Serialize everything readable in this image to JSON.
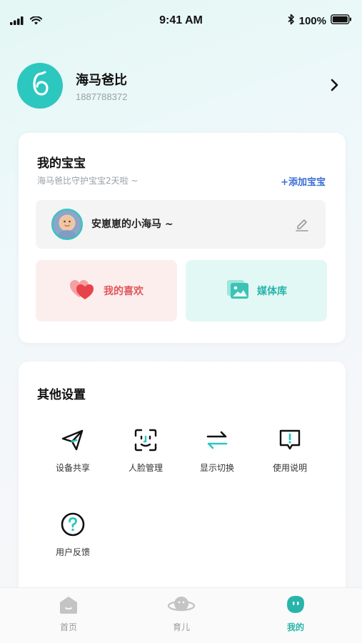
{
  "status_bar": {
    "time": "9:41 AM",
    "battery": "100%",
    "icons": [
      "signal-icon",
      "wifi-icon",
      "bluetooth-icon",
      "battery-icon"
    ]
  },
  "profile": {
    "name": "海马爸比",
    "phone": "1887788372",
    "avatar_icon": "seahorse-logo-icon",
    "accent": "#2cc7bf"
  },
  "baby_section": {
    "title": "我的宝宝",
    "subtitle": "海马爸比守护宝宝2天啦 ~",
    "add_label": "+添加宝宝",
    "baby_name": "安崽崽的小海马 ~",
    "favorites_label": "我的喜欢",
    "media_label": "媒体库"
  },
  "settings": {
    "title": "其他设置",
    "items": [
      {
        "label": "设备共享",
        "icon": "paper-plane-icon"
      },
      {
        "label": "人脸管理",
        "icon": "face-scan-icon"
      },
      {
        "label": "显示切换",
        "icon": "switch-arrows-icon"
      },
      {
        "label": "使用说明",
        "icon": "instructions-icon"
      },
      {
        "label": "用户反馈",
        "icon": "question-icon"
      }
    ]
  },
  "tabbar": {
    "tabs": [
      {
        "label": "首页",
        "icon": "home-icon",
        "active": false
      },
      {
        "label": "育儿",
        "icon": "planet-icon",
        "active": false
      },
      {
        "label": "我的",
        "icon": "me-icon",
        "active": true
      }
    ]
  },
  "colors": {
    "teal": "#2cc7bf",
    "link_blue": "#3a6ed8",
    "favorite_red": "#e0575a",
    "inactive_gray": "#9a9a9a"
  }
}
